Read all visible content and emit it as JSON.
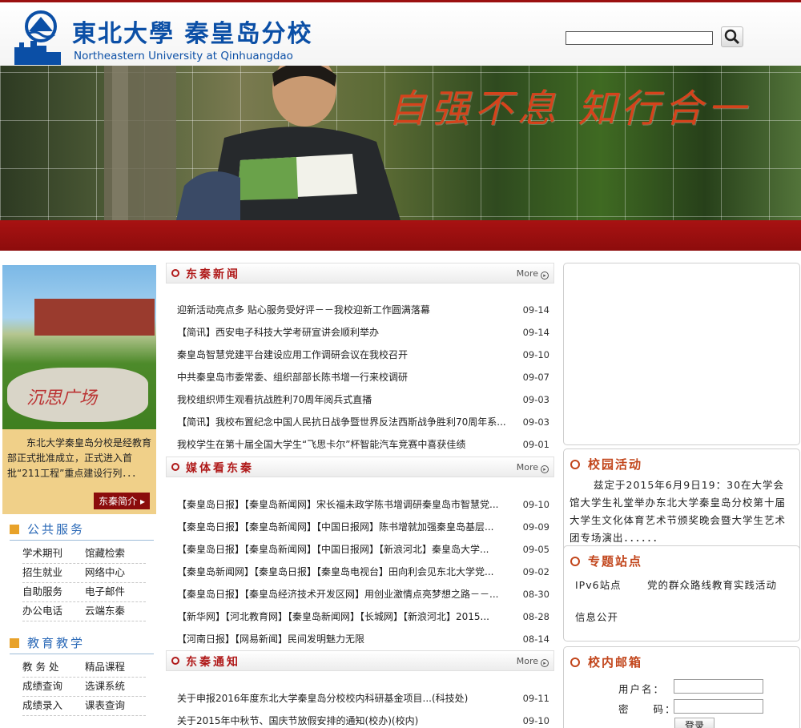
{
  "header": {
    "brand_cn": "東北大學 秦皇岛分校",
    "brand_en": "Northeastern University at Qinhuangdao",
    "search": {
      "value": "",
      "placeholder": ""
    }
  },
  "banner": {
    "slogan": "自强不息 知行合一"
  },
  "left": {
    "campus_stone_text": "沉思广场",
    "intro_text": "东北大学秦皇岛分校是经教育部正式批准成立，正式进入首批“211工程”重点建设行列．．．",
    "intro_button": "东秦简介",
    "public_services": {
      "title": "公共服务",
      "links": [
        "学术期刊",
        "馆藏检索",
        "招生就业",
        "网络中心",
        "自助服务",
        "电子邮件",
        "办公电话",
        "云端东秦"
      ]
    },
    "education": {
      "title": "教育教学",
      "links": [
        "教 务 处",
        "精品课程",
        "成绩查询",
        "选课系统",
        "成绩录入",
        "课表查询"
      ]
    }
  },
  "news": {
    "title": "东秦新闻",
    "more": "More",
    "items": [
      {
        "title": "迎新活动亮点多 贴心服务受好评－－我校迎新工作圆满落幕",
        "date": "09-14"
      },
      {
        "title": "【简讯】西安电子科技大学考研宣讲会顺利举办",
        "date": "09-14"
      },
      {
        "title": "秦皇岛智慧党建平台建设应用工作调研会议在我校召开",
        "date": "09-10"
      },
      {
        "title": "中共秦皇岛市委常委、组织部部长陈书增一行来校调研",
        "date": "09-07"
      },
      {
        "title": "我校组织师生观看抗战胜利70周年阅兵式直播",
        "date": "09-03"
      },
      {
        "title": "【简讯】我校布置纪念中国人民抗日战争暨世界反法西斯战争胜利70周年系...",
        "date": "09-03"
      },
      {
        "title": "我校学生在第十届全国大学生“飞思卡尔”杯智能汽车竞赛中喜获佳绩",
        "date": "09-01"
      }
    ]
  },
  "media": {
    "title": "媒体看东秦",
    "more": "More",
    "items": [
      {
        "title": "【秦皇岛日报】【秦皇岛新闻网】宋长福未政学陈书增调研秦皇岛市智慧党...",
        "date": "09-10"
      },
      {
        "title": "【秦皇岛日报】【秦皇岛新闻网】【中国日报网】陈书增就加强秦皇岛基层...",
        "date": "09-09"
      },
      {
        "title": "【秦皇岛日报】【秦皇岛新闻网】【中国日报网】【新浪河北】秦皇岛大学...",
        "date": "09-05"
      },
      {
        "title": "【秦皇岛新闻网】【秦皇岛日报】【秦皇岛电视台】田向利会见东北大学党...",
        "date": "09-02"
      },
      {
        "title": "【秦皇岛日报】【秦皇岛经济技术开发区网】用创业激情点亮梦想之路－－...",
        "date": "08-30"
      },
      {
        "title": "【新华网】【河北教育网】【秦皇岛新闻网】【长城网】【新浪河北】2015...",
        "date": "08-28"
      },
      {
        "title": "【河南日报】【网易新闻】民间发明魅力无限",
        "date": "08-14"
      }
    ]
  },
  "notices": {
    "title": "东秦通知",
    "more": "More",
    "items": [
      {
        "title": "关于申报2016年度东北大学秦皇岛分校校内科研基金项目...(科技处)",
        "date": "09-11"
      },
      {
        "title": "关于2015年中秋节、国庆节放假安排的通知(校办)(校内)",
        "date": "09-10"
      }
    ]
  },
  "right": {
    "campus_activity": {
      "title": "校园活动",
      "text": "兹定于2015年6月9日19：30在大学会馆大学生礼堂举办东北大学秦皇岛分校第十届大学生文化体育艺术节颁奖晚会暨大学生艺术团专场演出．．．．．．"
    },
    "topics": {
      "title": "专题站点",
      "links": [
        "IPv6站点",
        "党的群众路线教育实践活动",
        "信息公开"
      ]
    },
    "mailbox": {
      "title": "校内邮箱",
      "user_label": "用户名：",
      "pass_label": "密　　码：",
      "login_button": "登录"
    }
  },
  "colors": {
    "brand_blue": "#0b4fa6",
    "accent_red": "#9b1010",
    "title_red": "#b01a1a",
    "intro_bg": "#f0d089"
  }
}
